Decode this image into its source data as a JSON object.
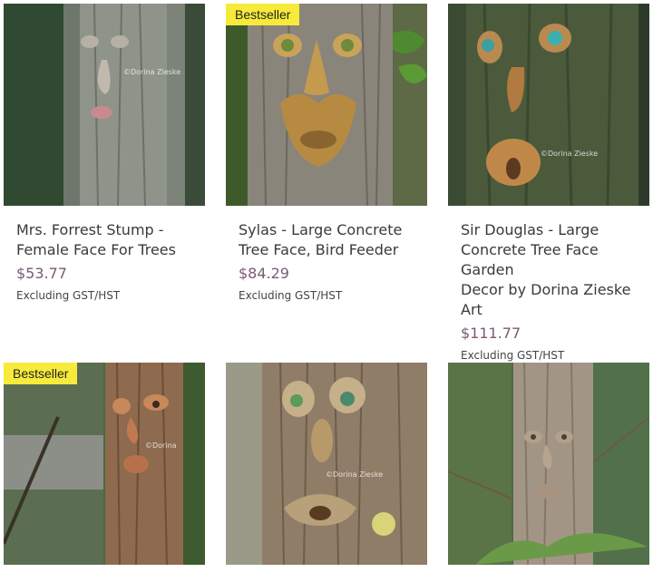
{
  "products": [
    {
      "title_line1": "Mrs. Forrest Stump -",
      "title_line2": "Female Face For Trees",
      "title_line3": "",
      "price": "$53.77",
      "tax_note": "Excluding GST/HST",
      "badge": "",
      "watermark": "©Dorina Zieske"
    },
    {
      "title_line1": "Sylas - Large Concrete",
      "title_line2": "Tree Face, Bird Feeder",
      "title_line3": "",
      "price": "$84.29",
      "tax_note": "Excluding GST/HST",
      "badge": "Bestseller",
      "watermark": ""
    },
    {
      "title_line1": "Sir Douglas - Large",
      "title_line2": "Concrete Tree Face Garden",
      "title_line3": "Decor by Dorina Zieske Art",
      "price": "$111.77",
      "tax_note": "Excluding GST/HST",
      "badge": "",
      "watermark": "©Dorina Zieske"
    },
    {
      "badge": "Bestseller",
      "watermark": "©Dorina"
    },
    {
      "badge": "",
      "watermark": "©Dorina Zieske"
    },
    {
      "badge": "",
      "watermark": ""
    }
  ],
  "colors": {
    "badge_bg": "#f6ea3a",
    "price": "#7a5a74",
    "title": "#3a3a3a"
  }
}
